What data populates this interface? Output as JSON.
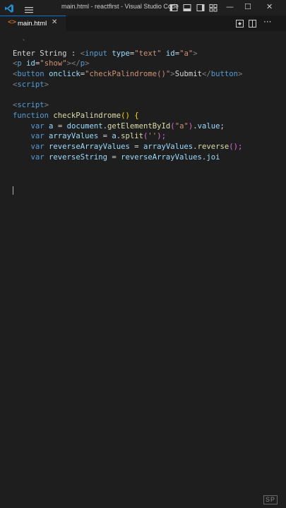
{
  "window": {
    "title": "main.html - reactfirst - Visual Studio Code",
    "minimize": "—",
    "maximize": "☐",
    "close": "✕"
  },
  "tabs": [
    {
      "label": "main.html",
      "icon": "html-file-icon",
      "close": "✕"
    }
  ],
  "tab_more": "···",
  "code": {
    "l1": [
      "Enter String : ",
      "<",
      "input",
      " ",
      "type",
      "=",
      "\"text\"",
      " ",
      "id",
      "=",
      "\"a\"",
      ">"
    ],
    "l2": [
      "<",
      "p",
      " ",
      "id",
      "=",
      "\"show\"",
      "></",
      "p",
      ">"
    ],
    "l3": [
      "<",
      "button",
      " ",
      "onclick",
      "=",
      "\"checkPalindrome()\"",
      ">",
      "Submit",
      "</",
      "button",
      ">"
    ],
    "l4": [
      "<",
      "script",
      ">"
    ],
    "l5": [
      "<",
      "script",
      ">"
    ],
    "l6": [
      "function",
      " ",
      "checkPalindrome",
      "(",
      ")",
      " ",
      "{"
    ],
    "l7": [
      "    ",
      "var",
      " ",
      "a",
      " = ",
      "document",
      ".",
      "getElementById",
      "(",
      "\"a\"",
      ")",
      ".",
      "value",
      ";"
    ],
    "l8": [
      "    ",
      "var",
      " ",
      "arrayValues",
      " = ",
      "a",
      ".",
      "split",
      "(",
      "''",
      ");"
    ],
    "l9": [
      "    ",
      "var",
      " ",
      "reverseArrayValues",
      " = ",
      "arrayValues",
      ".",
      "reverse",
      "(",
      ");"
    ],
    "l10": [
      "    ",
      "var",
      " ",
      "reverseString",
      " = ",
      "reverseArrayValues",
      ".",
      "joi"
    ]
  },
  "watermark": "SP",
  "colors": {
    "accent": "#0078d4",
    "editor_bg": "#1e1e1e",
    "tag": "#569cd6",
    "attr": "#9cdcfe",
    "string": "#ce9178",
    "function": "#dcdcaa"
  }
}
